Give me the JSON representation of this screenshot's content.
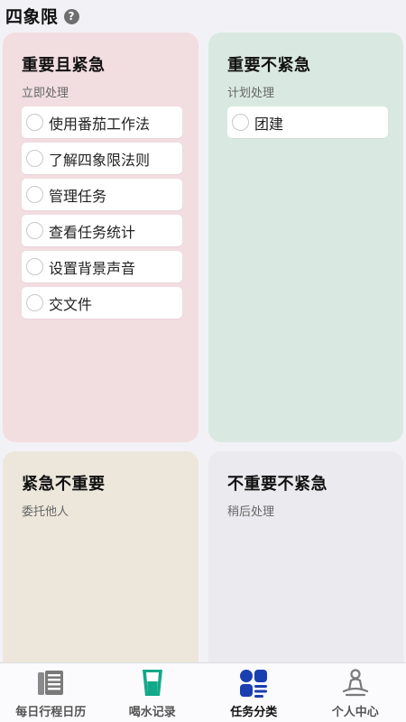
{
  "header": {
    "title": "四象限",
    "help_symbol": "?"
  },
  "quadrants": {
    "q1": {
      "title": "重要且紧急",
      "subtitle": "立即处理",
      "color": "#f2dde1",
      "tasks": [
        "使用番茄工作法",
        "了解四象限法则",
        "管理任务",
        "查看任务统计",
        "设置背景声音",
        "交文件"
      ]
    },
    "q2": {
      "title": "重要不紧急",
      "subtitle": "计划处理",
      "color": "#d9e9e1",
      "tasks": [
        "团建"
      ]
    },
    "q3": {
      "title": "紧急不重要",
      "subtitle": "委托他人",
      "color": "#ede6db",
      "tasks": []
    },
    "q4": {
      "title": "不重要不紧急",
      "subtitle": "稍后处理",
      "color": "#ebebef",
      "tasks": []
    }
  },
  "nav": {
    "items": [
      {
        "label": "每日行程日历",
        "icon": "calendar-icon",
        "active": false
      },
      {
        "label": "喝水记录",
        "icon": "water-cup-icon",
        "active": false
      },
      {
        "label": "任务分类",
        "icon": "quadrant-grid-icon",
        "active": true
      },
      {
        "label": "个人中心",
        "icon": "meditation-person-icon",
        "active": false
      }
    ],
    "active_color": "#1a3fb0",
    "water_color": "#12a88a"
  }
}
